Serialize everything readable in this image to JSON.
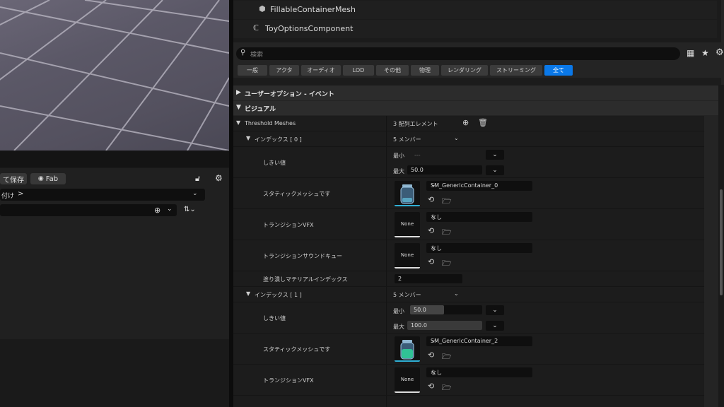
{
  "left": {
    "save_label": "て保存",
    "fab_label": "Fab",
    "breadcrumb_text": "付け",
    "breadcrumb_chev": ">"
  },
  "tree": {
    "item1": "FillableContainerMesh",
    "item2": "ToyOptionsComponent"
  },
  "search": {
    "placeholder": "検索"
  },
  "tabs": [
    "一般",
    "アクタ",
    "オーディオ",
    "LOD",
    "その他",
    "物理",
    "レンダリング",
    "ストリーミング",
    "全て"
  ],
  "active_tab": "全て",
  "sections": {
    "user_options": "ユーザーオプション - イベント",
    "visual": "ビジュアル"
  },
  "threshold": {
    "label": "Threshold Meshes",
    "count_label": "3 配列エレメント"
  },
  "index0": {
    "label": "インデックス [ 0 ]",
    "members": "5 メンバー",
    "threshold_label": "しきい値",
    "min_label": "最小",
    "min_value": "---",
    "max_label": "最大",
    "max_value": "50.0",
    "static_mesh_label": "スタティックメッシュです",
    "static_mesh_value": "SM_GenericContainer_0",
    "vfx_label": "トランジションVFX",
    "vfx_value": "なし",
    "vfx_thumb": "None",
    "sound_label": "トランジションサウンドキュー",
    "sound_value": "なし",
    "sound_thumb": "None",
    "fill_mat_label": "塗り潰しマテリアルインデックス",
    "fill_mat_value": "2"
  },
  "index1": {
    "label": "インデックス [ 1 ]",
    "members": "5 メンバー",
    "threshold_label": "しきい値",
    "min_label": "最小",
    "min_value": "50.0",
    "max_label": "最大",
    "max_value": "100.0",
    "static_mesh_label": "スタティックメッシュです",
    "static_mesh_value": "SM_GenericContainer_2",
    "vfx_label": "トランジションVFX",
    "vfx_value": "なし",
    "vfx_thumb": "None"
  },
  "colors": {
    "accent": "#0a78e8",
    "jar_liquid": "#2fd39a"
  }
}
